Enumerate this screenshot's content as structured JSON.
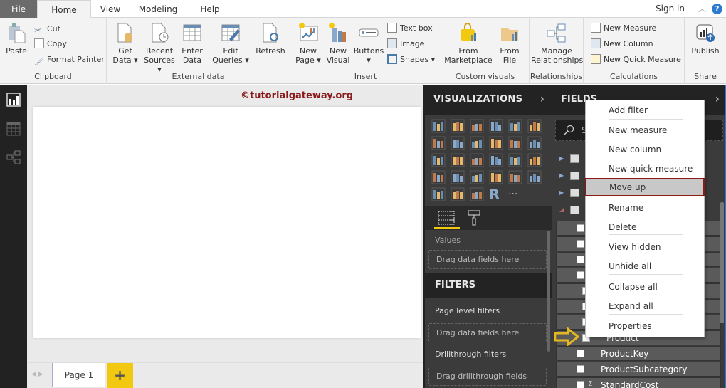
{
  "tabs": {
    "file": "File",
    "home": "Home",
    "view": "View",
    "modeling": "Modeling",
    "help": "Help"
  },
  "topright": {
    "sign_in": "Sign in",
    "help_icon": "?"
  },
  "ribbon": {
    "clipboard": {
      "label": "Clipboard",
      "paste": "Paste",
      "cut": "Cut",
      "copy": "Copy",
      "format_painter": "Format Painter"
    },
    "external_data": {
      "label": "External data",
      "get_data": [
        "Get",
        "Data ▾"
      ],
      "recent_sources": [
        "Recent",
        "Sources ▾"
      ],
      "enter_data": [
        "Enter",
        "Data"
      ],
      "edit_queries": [
        "Edit",
        "Queries ▾"
      ],
      "refresh": "Refresh"
    },
    "insert": {
      "label": "Insert",
      "new_page": [
        "New",
        "Page ▾"
      ],
      "new_visual": [
        "New",
        "Visual"
      ],
      "buttons": [
        "Buttons",
        "▾"
      ],
      "text_box": "Text box",
      "image": "Image",
      "shapes": "Shapes ▾"
    },
    "custom_visuals": {
      "label": "Custom visuals",
      "from_marketplace": [
        "From",
        "Marketplace"
      ],
      "from_file": [
        "From",
        "File"
      ]
    },
    "relationships": {
      "label": "Relationships",
      "manage": [
        "Manage",
        "Relationships"
      ]
    },
    "calculations": {
      "label": "Calculations",
      "new_measure": "New Measure",
      "new_column": "New Column",
      "new_quick_measure": "New Quick Measure"
    },
    "share": {
      "label": "Share",
      "publish": "Publish"
    }
  },
  "canvas": {
    "watermark": "©tutorialgateway.org",
    "page_tab": "Page 1",
    "add_page": "+"
  },
  "visualizations": {
    "title": "VISUALIZATIONS",
    "icons": [
      "stacked-bar-icon",
      "stacked-column-icon",
      "clustered-bar-icon",
      "clustered-column-icon",
      "100-stacked-bar-icon",
      "100-stacked-column-icon",
      "line-chart-icon",
      "area-chart-icon",
      "stacked-area-icon",
      "line-clustered-column-icon",
      "line-stacked-column-icon",
      "ribbon-chart-icon",
      "waterfall-icon",
      "scatter-icon",
      "pie-icon",
      "donut-icon",
      "treemap-icon",
      "map-icon",
      "filled-map-icon",
      "funnel-icon",
      "gauge-icon",
      "card-icon",
      "multirow-card-icon",
      "kpi-icon",
      "slicer-icon",
      "table-icon",
      "matrix-icon",
      "r-visual-icon",
      "more-visuals-icon"
    ],
    "values_label": "Values",
    "values_drop": "Drag data fields here"
  },
  "filters": {
    "title": "FILTERS",
    "page_level": "Page level filters",
    "page_drop": "Drag data fields here",
    "drillthrough": "Drillthrough filters",
    "drillthrough_drop": "Drag drillthrough fields here"
  },
  "fields": {
    "title": "FIELDS",
    "search_placeholder": "S",
    "rows": [
      {
        "name": "",
        "indent": false,
        "sigma": false
      },
      {
        "name": "",
        "indent": false,
        "sigma": false
      },
      {
        "name": "",
        "indent": false,
        "sigma": false
      },
      {
        "name": "",
        "indent": false,
        "sigma": false
      },
      {
        "name": "",
        "indent": true,
        "sigma": false
      },
      {
        "name": "",
        "indent": true,
        "sigma": false
      },
      {
        "name": "",
        "indent": true,
        "sigma": false
      },
      {
        "name": "Product",
        "indent": true,
        "sigma": false
      },
      {
        "name": "ProductKey",
        "indent": false,
        "sigma": false
      },
      {
        "name": "ProductSubcategory",
        "indent": false,
        "sigma": false
      },
      {
        "name": "StandardCost",
        "indent": false,
        "sigma": true
      }
    ]
  },
  "context_menu": {
    "items": [
      {
        "label": "Add filter"
      },
      {
        "label": "New measure"
      },
      {
        "label": "New column"
      },
      {
        "label": "New quick measure"
      },
      {
        "label": "Move up",
        "highlighted": true
      },
      {
        "label": "Rename"
      },
      {
        "label": "Delete"
      },
      {
        "label": "View hidden"
      },
      {
        "label": "Unhide all"
      },
      {
        "label": "Collapse all"
      },
      {
        "label": "Expand all"
      },
      {
        "label": "Properties"
      }
    ]
  },
  "colors": {
    "accent_yellow": "#f2c811",
    "highlight_border": "#8b1a1a",
    "watermark": "#8b1a1a",
    "pane_dark": "#3b3b3b"
  }
}
